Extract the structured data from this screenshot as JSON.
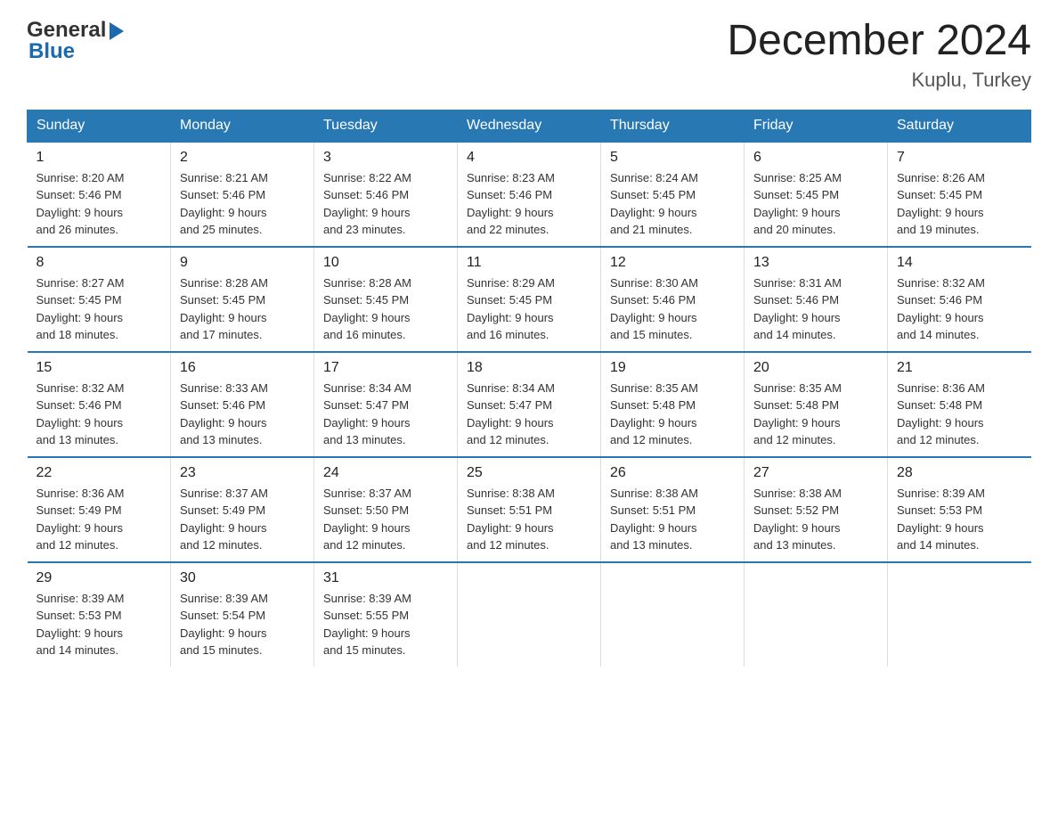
{
  "header": {
    "logo_text1": "General",
    "logo_text2": "Blue",
    "month_title": "December 2024",
    "location": "Kuplu, Turkey"
  },
  "days_of_week": [
    "Sunday",
    "Monday",
    "Tuesday",
    "Wednesday",
    "Thursday",
    "Friday",
    "Saturday"
  ],
  "weeks": [
    [
      {
        "day": "1",
        "sunrise": "8:20 AM",
        "sunset": "5:46 PM",
        "daylight": "9 hours and 26 minutes."
      },
      {
        "day": "2",
        "sunrise": "8:21 AM",
        "sunset": "5:46 PM",
        "daylight": "9 hours and 25 minutes."
      },
      {
        "day": "3",
        "sunrise": "8:22 AM",
        "sunset": "5:46 PM",
        "daylight": "9 hours and 23 minutes."
      },
      {
        "day": "4",
        "sunrise": "8:23 AM",
        "sunset": "5:46 PM",
        "daylight": "9 hours and 22 minutes."
      },
      {
        "day": "5",
        "sunrise": "8:24 AM",
        "sunset": "5:45 PM",
        "daylight": "9 hours and 21 minutes."
      },
      {
        "day": "6",
        "sunrise": "8:25 AM",
        "sunset": "5:45 PM",
        "daylight": "9 hours and 20 minutes."
      },
      {
        "day": "7",
        "sunrise": "8:26 AM",
        "sunset": "5:45 PM",
        "daylight": "9 hours and 19 minutes."
      }
    ],
    [
      {
        "day": "8",
        "sunrise": "8:27 AM",
        "sunset": "5:45 PM",
        "daylight": "9 hours and 18 minutes."
      },
      {
        "day": "9",
        "sunrise": "8:28 AM",
        "sunset": "5:45 PM",
        "daylight": "9 hours and 17 minutes."
      },
      {
        "day": "10",
        "sunrise": "8:28 AM",
        "sunset": "5:45 PM",
        "daylight": "9 hours and 16 minutes."
      },
      {
        "day": "11",
        "sunrise": "8:29 AM",
        "sunset": "5:45 PM",
        "daylight": "9 hours and 16 minutes."
      },
      {
        "day": "12",
        "sunrise": "8:30 AM",
        "sunset": "5:46 PM",
        "daylight": "9 hours and 15 minutes."
      },
      {
        "day": "13",
        "sunrise": "8:31 AM",
        "sunset": "5:46 PM",
        "daylight": "9 hours and 14 minutes."
      },
      {
        "day": "14",
        "sunrise": "8:32 AM",
        "sunset": "5:46 PM",
        "daylight": "9 hours and 14 minutes."
      }
    ],
    [
      {
        "day": "15",
        "sunrise": "8:32 AM",
        "sunset": "5:46 PM",
        "daylight": "9 hours and 13 minutes."
      },
      {
        "day": "16",
        "sunrise": "8:33 AM",
        "sunset": "5:46 PM",
        "daylight": "9 hours and 13 minutes."
      },
      {
        "day": "17",
        "sunrise": "8:34 AM",
        "sunset": "5:47 PM",
        "daylight": "9 hours and 13 minutes."
      },
      {
        "day": "18",
        "sunrise": "8:34 AM",
        "sunset": "5:47 PM",
        "daylight": "9 hours and 12 minutes."
      },
      {
        "day": "19",
        "sunrise": "8:35 AM",
        "sunset": "5:48 PM",
        "daylight": "9 hours and 12 minutes."
      },
      {
        "day": "20",
        "sunrise": "8:35 AM",
        "sunset": "5:48 PM",
        "daylight": "9 hours and 12 minutes."
      },
      {
        "day": "21",
        "sunrise": "8:36 AM",
        "sunset": "5:48 PM",
        "daylight": "9 hours and 12 minutes."
      }
    ],
    [
      {
        "day": "22",
        "sunrise": "8:36 AM",
        "sunset": "5:49 PM",
        "daylight": "9 hours and 12 minutes."
      },
      {
        "day": "23",
        "sunrise": "8:37 AM",
        "sunset": "5:49 PM",
        "daylight": "9 hours and 12 minutes."
      },
      {
        "day": "24",
        "sunrise": "8:37 AM",
        "sunset": "5:50 PM",
        "daylight": "9 hours and 12 minutes."
      },
      {
        "day": "25",
        "sunrise": "8:38 AM",
        "sunset": "5:51 PM",
        "daylight": "9 hours and 12 minutes."
      },
      {
        "day": "26",
        "sunrise": "8:38 AM",
        "sunset": "5:51 PM",
        "daylight": "9 hours and 13 minutes."
      },
      {
        "day": "27",
        "sunrise": "8:38 AM",
        "sunset": "5:52 PM",
        "daylight": "9 hours and 13 minutes."
      },
      {
        "day": "28",
        "sunrise": "8:39 AM",
        "sunset": "5:53 PM",
        "daylight": "9 hours and 14 minutes."
      }
    ],
    [
      {
        "day": "29",
        "sunrise": "8:39 AM",
        "sunset": "5:53 PM",
        "daylight": "9 hours and 14 minutes."
      },
      {
        "day": "30",
        "sunrise": "8:39 AM",
        "sunset": "5:54 PM",
        "daylight": "9 hours and 15 minutes."
      },
      {
        "day": "31",
        "sunrise": "8:39 AM",
        "sunset": "5:55 PM",
        "daylight": "9 hours and 15 minutes."
      },
      null,
      null,
      null,
      null
    ]
  ],
  "labels": {
    "sunrise": "Sunrise:",
    "sunset": "Sunset:",
    "daylight": "Daylight:"
  }
}
